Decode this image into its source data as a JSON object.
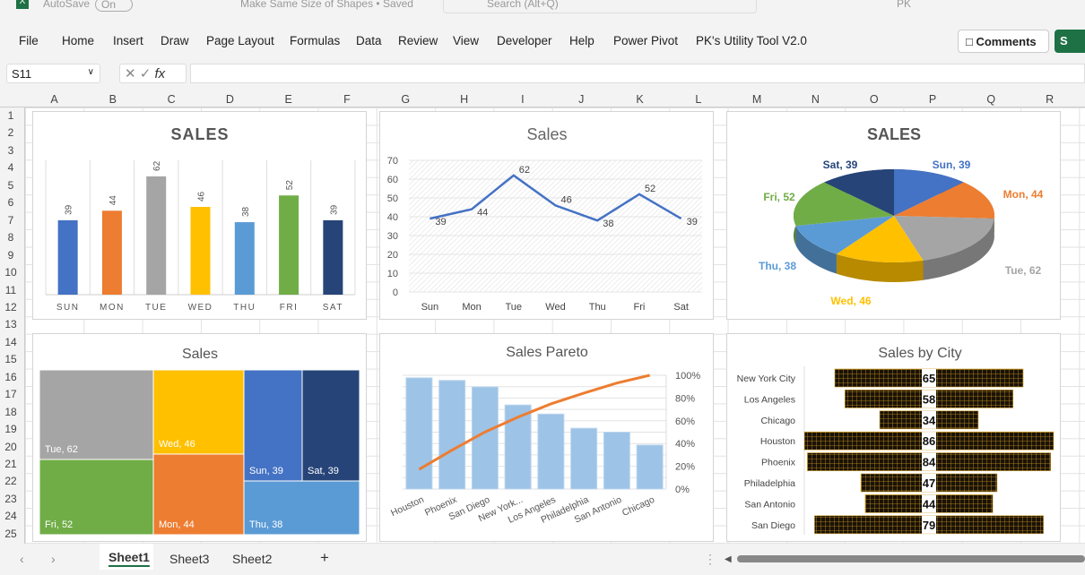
{
  "titlebar": {
    "autosave": "AutoSave",
    "autosave_state": "On",
    "doc_title": "Make Same Size of Shapes • Saved",
    "search_placeholder": "Search (Alt+Q)",
    "user": "PK"
  },
  "menu": [
    "File",
    "Home",
    "Insert",
    "Draw",
    "Page Layout",
    "Formulas",
    "Data",
    "Review",
    "View",
    "Developer",
    "Help",
    "Power Pivot",
    "PK's Utility Tool V2.0"
  ],
  "comments_label": "Comments",
  "share_label": "S",
  "formula_bar": {
    "name_box": "S11",
    "fx": "fx",
    "value": ""
  },
  "columns": [
    "A",
    "B",
    "C",
    "D",
    "E",
    "F",
    "G",
    "H",
    "I",
    "J",
    "K",
    "L",
    "M",
    "N",
    "O",
    "P",
    "Q",
    "R"
  ],
  "rows": [
    "1",
    "2",
    "3",
    "4",
    "5",
    "6",
    "7",
    "8",
    "9",
    "10",
    "11",
    "12",
    "13",
    "14",
    "15",
    "16",
    "17",
    "18",
    "19",
    "20",
    "21",
    "22",
    "23",
    "24",
    "25"
  ],
  "sheet_tabs": {
    "tabs": [
      "Sheet1",
      "Sheet3",
      "Sheet2"
    ],
    "active": "Sheet1",
    "add": "+"
  },
  "colors": {
    "Sun": "#4472c4",
    "Mon": "#ed7d31",
    "Tue": "#a5a5a5",
    "Wed": "#ffc000",
    "Thu": "#5b9bd5",
    "Fri": "#70ad47",
    "Sat": "#264478"
  },
  "chart_data": [
    {
      "type": "bar",
      "title": "SALES",
      "categories": [
        "SUN",
        "MON",
        "TUE",
        "WED",
        "THU",
        "FRI",
        "SAT"
      ],
      "values": [
        39,
        44,
        62,
        46,
        38,
        52,
        39
      ],
      "data_labels": true
    },
    {
      "type": "line",
      "title": "Sales",
      "categories": [
        "Sun",
        "Mon",
        "Tue",
        "Wed",
        "Thu",
        "Fri",
        "Sat"
      ],
      "values": [
        39,
        44,
        62,
        46,
        38,
        52,
        39
      ],
      "ylim": [
        0,
        70
      ],
      "yticks": [
        "0",
        "10",
        "20",
        "30",
        "40",
        "50",
        "60",
        "70"
      ],
      "color": "#4472c4"
    },
    {
      "type": "pie",
      "title": "SALES",
      "categories": [
        "Sun",
        "Mon",
        "Tue",
        "Wed",
        "Thu",
        "Fri",
        "Sat"
      ],
      "values": [
        39,
        44,
        62,
        46,
        38,
        52,
        39
      ],
      "style": "3d"
    },
    {
      "type": "treemap",
      "title": "Sales",
      "categories": [
        "Tue",
        "Fri",
        "Wed",
        "Mon",
        "Sun",
        "Sat",
        "Thu"
      ],
      "values": [
        62,
        52,
        46,
        44,
        39,
        39,
        38
      ]
    },
    {
      "type": "pareto",
      "title": "Sales Pareto",
      "categories": [
        "Houston",
        "Phoenix",
        "San Diego",
        "New York...",
        "Los Angeles",
        "Philadelphia",
        "San Antonio",
        "Chicago"
      ],
      "values": [
        86,
        84,
        79,
        65,
        58,
        47,
        44,
        34
      ],
      "y2ticks": [
        "0%",
        "20%",
        "40%",
        "60%",
        "80%",
        "100%"
      ],
      "bar_color": "#9dc3e6",
      "line_color": "#ed7d31"
    },
    {
      "type": "bar",
      "orientation": "horizontal-centered",
      "title": "Sales by City",
      "categories": [
        "New York City",
        "Los Angeles",
        "Chicago",
        "Houston",
        "Phoenix",
        "Philadelphia",
        "San Antonio",
        "San Diego"
      ],
      "values": [
        65,
        58,
        34,
        86,
        84,
        47,
        44,
        79
      ]
    }
  ]
}
